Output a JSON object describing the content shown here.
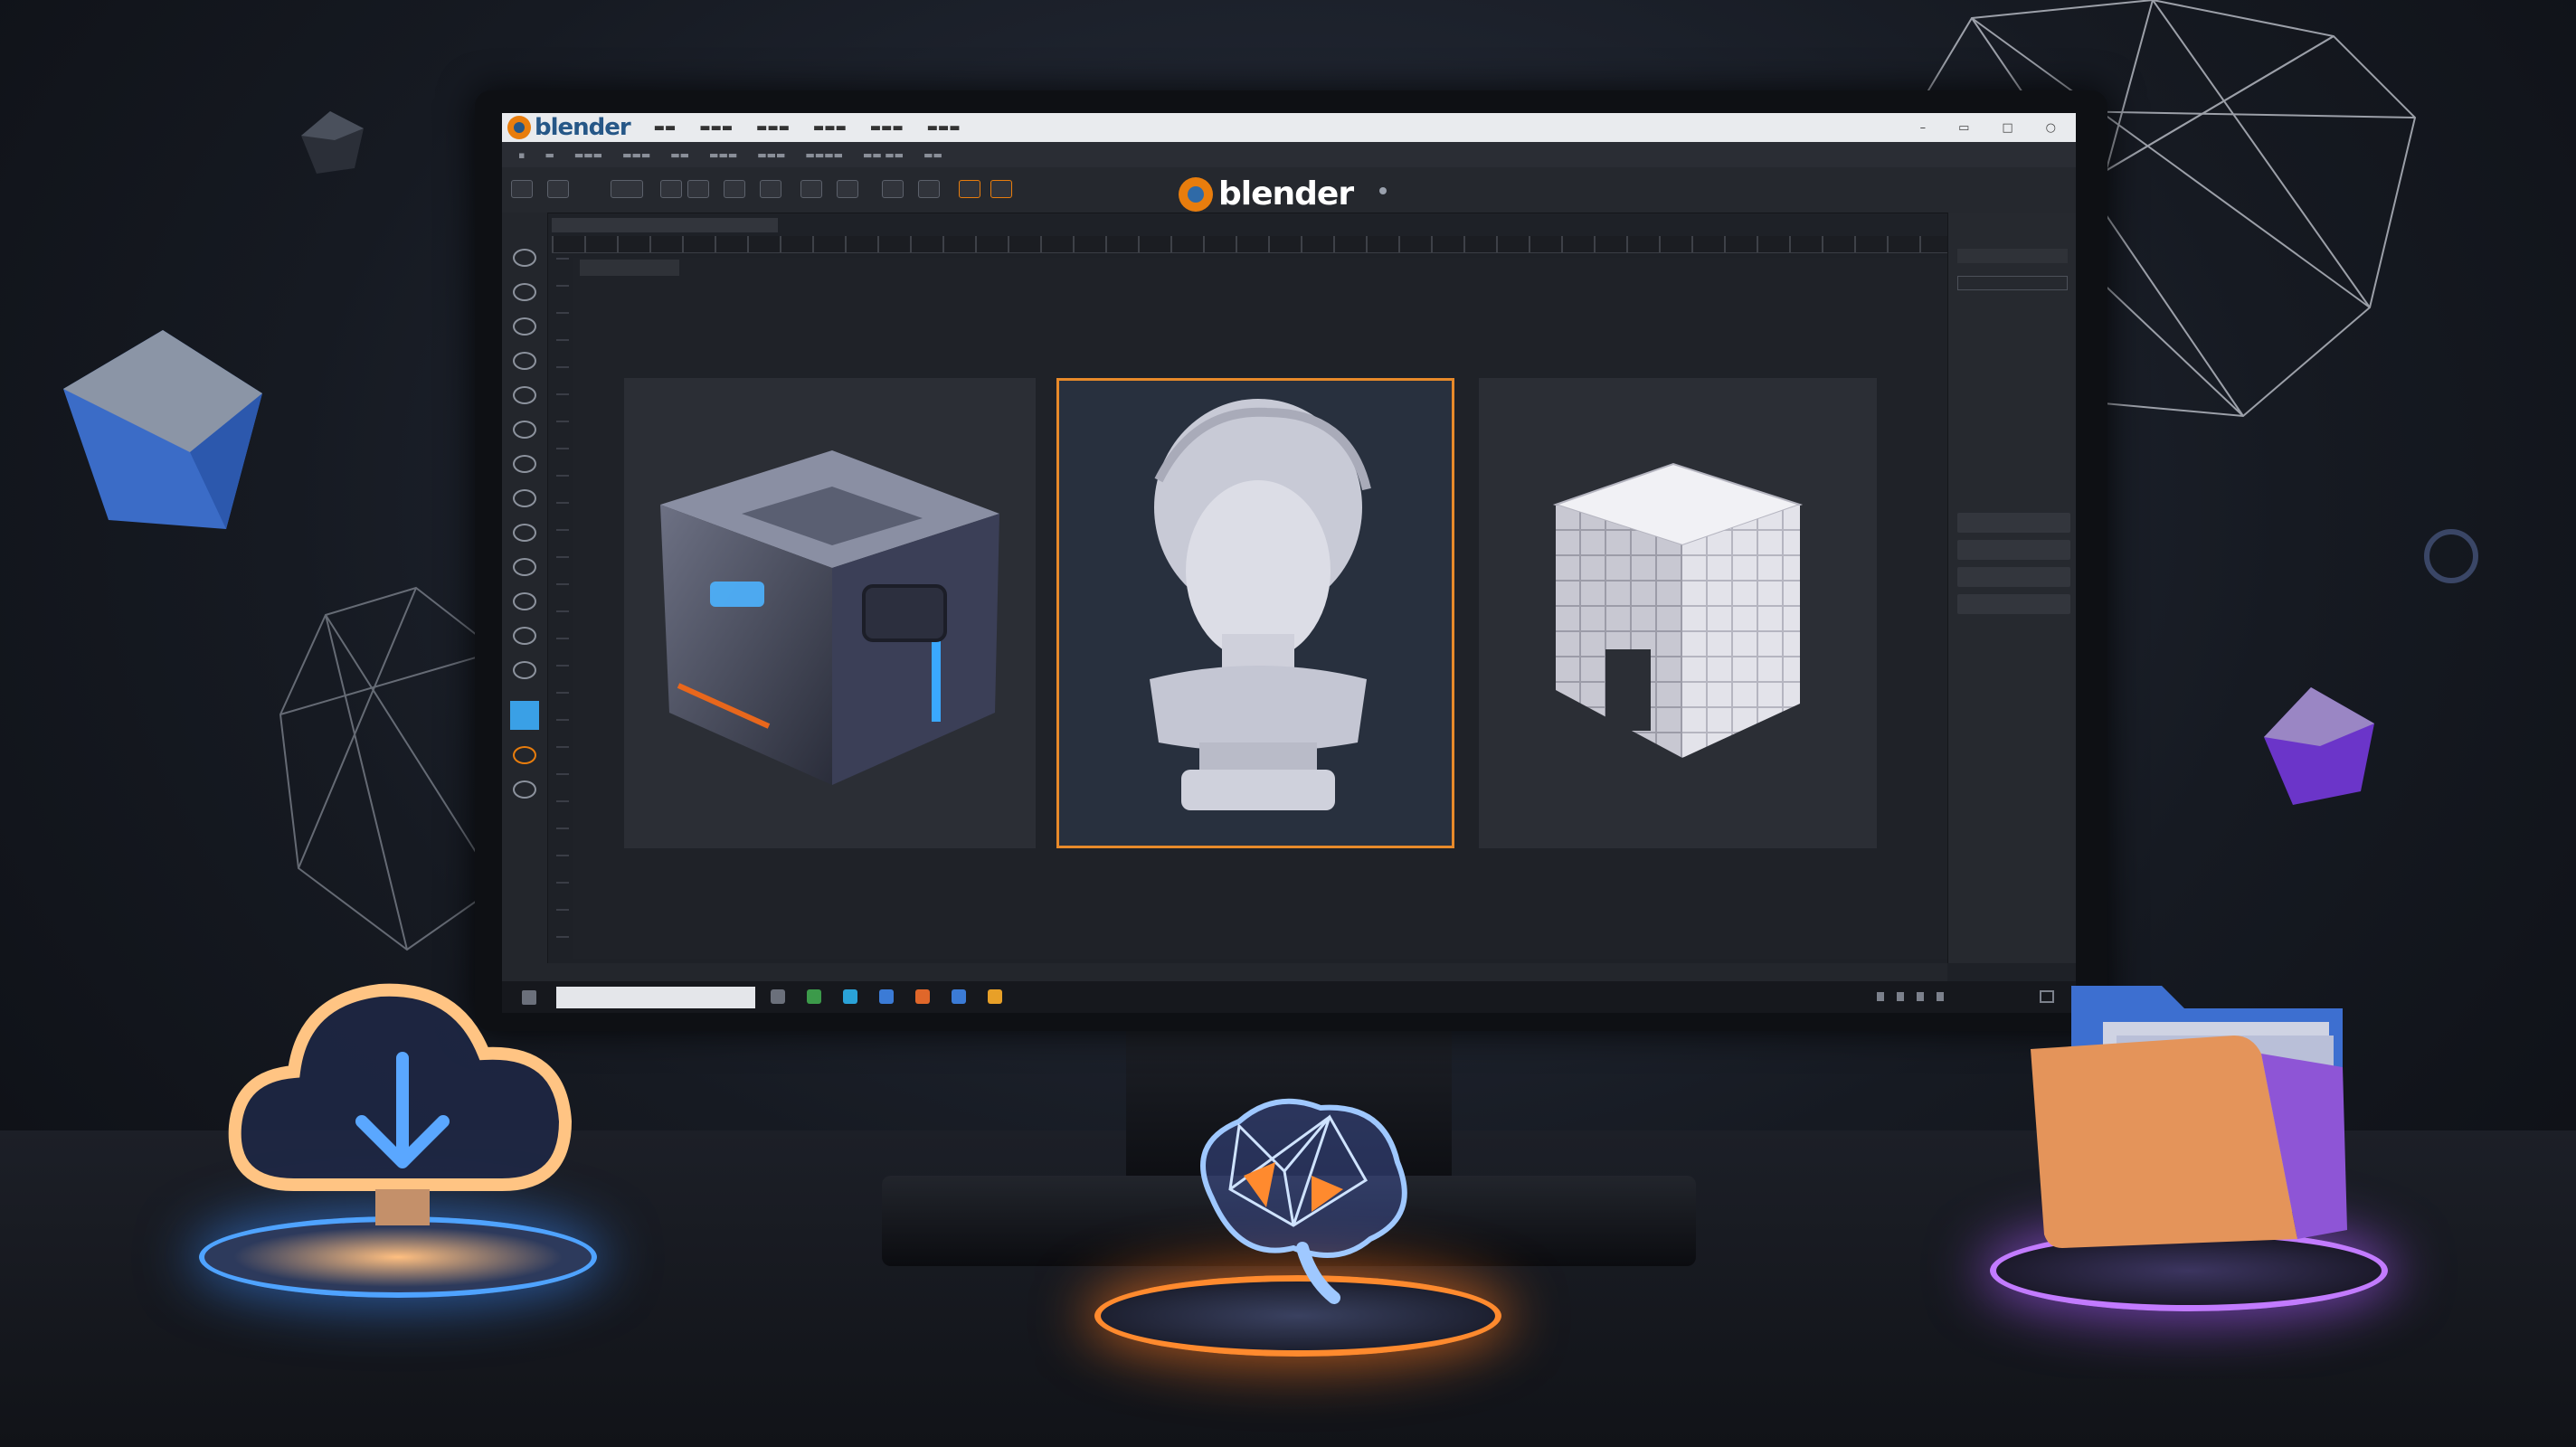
{
  "app": {
    "logo_text": "blender",
    "brand_text": "blender"
  },
  "colors": {
    "accent_orange": "#e87d0d",
    "accent_blue": "#265787",
    "selection_outline": "#e88a2a",
    "active_tool": "#3aa0e6"
  },
  "icons": [
    "blender-logo-icon",
    "cloud-download-icon",
    "brain-icon",
    "folder-icon",
    "cube-icon",
    "bust-sculpture",
    "voxel-cube"
  ]
}
